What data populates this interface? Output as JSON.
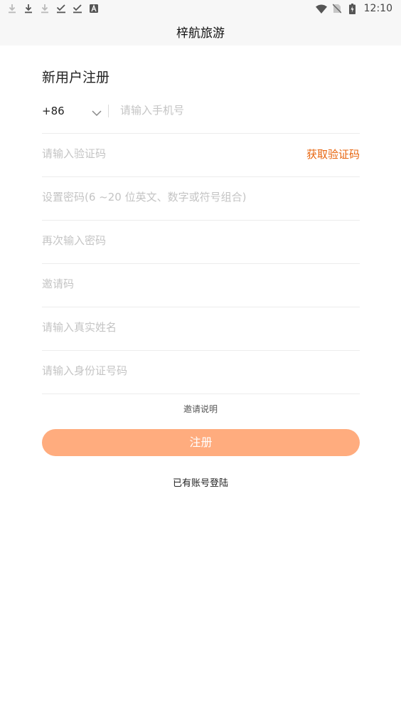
{
  "status_bar": {
    "left_icons": [
      "download-faded-icon",
      "download-icon",
      "download-faded-icon",
      "check-download-icon",
      "check-download-icon",
      "font-a-icon"
    ],
    "right_icons": [
      "wifi-icon",
      "no-sim-icon",
      "battery-charging-icon"
    ],
    "time": "12:10"
  },
  "app_bar": {
    "title": "梓航旅游"
  },
  "form": {
    "heading": "新用户注册",
    "country_code": "+86",
    "phone_placeholder": "请输入手机号",
    "code_placeholder": "请输入验证码",
    "get_code_label": "获取验证码",
    "password_placeholder": "设置密码(6 ~20 位英文、数字或符号组合)",
    "confirm_password_placeholder": "再次输入密码",
    "invite_code_placeholder": "邀请码",
    "real_name_placeholder": "请输入真实姓名",
    "id_number_placeholder": "请输入身份证号码",
    "invite_explanation_label": "邀请说明",
    "register_label": "注册",
    "login_link_label": "已有账号登陆"
  },
  "colors": {
    "accent_orange": "#e8650e",
    "button_fill": "#ffac7e",
    "placeholder_gray": "#c4c4c4",
    "bar_background": "#f7f7f7"
  }
}
